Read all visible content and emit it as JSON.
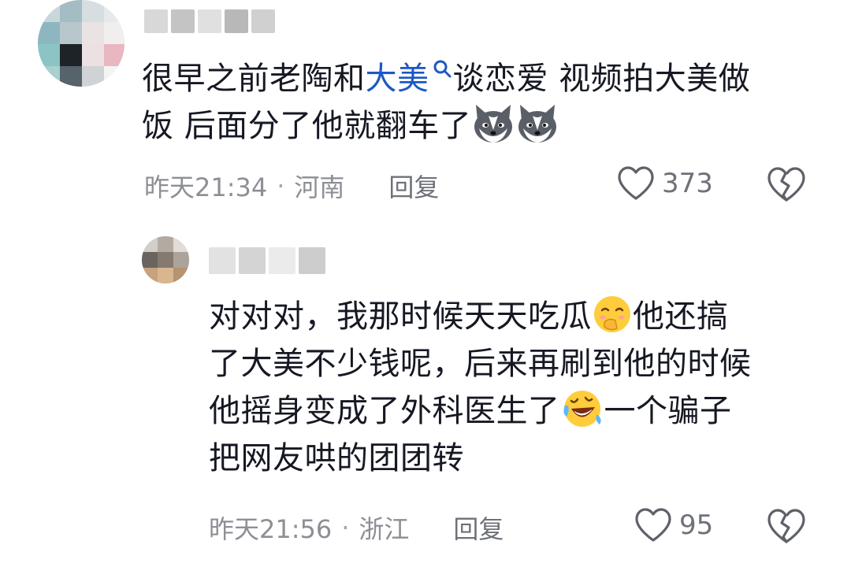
{
  "comments": [
    {
      "text_part1": "很早之前老陶和",
      "mention": "大美",
      "text_part2": "谈恋爱 视频拍大美做",
      "text_part3": "饭 后面分了他就翻车了",
      "time": "昨天21:34",
      "location": "河南",
      "reply_label": "回复",
      "likes": "373",
      "icons": [
        "mini-search-icon",
        "husky-dog-emoji",
        "husky-dog-emoji",
        "heart-icon",
        "broken-heart-icon"
      ]
    },
    {
      "line1_a": "对对对，我那时候天天吃瓜",
      "line1_b": "他还搞",
      "line2": "了大美不少钱呢，后来再刷到他的时候",
      "line3_a": "他摇身变成了外科医生了",
      "line3_b": "一个骗子",
      "line4": "把网友哄的团团转",
      "time": "昨天21:56",
      "location": "浙江",
      "reply_label": "回复",
      "likes": "95",
      "icons": [
        "giggle-emoji",
        "rolling-laugh-emoji",
        "heart-icon",
        "broken-heart-icon"
      ]
    }
  ],
  "colors": {
    "text": "#161823",
    "meta": "#8d8f95",
    "mention": "#1c58c6",
    "icon": "#5f6168"
  }
}
